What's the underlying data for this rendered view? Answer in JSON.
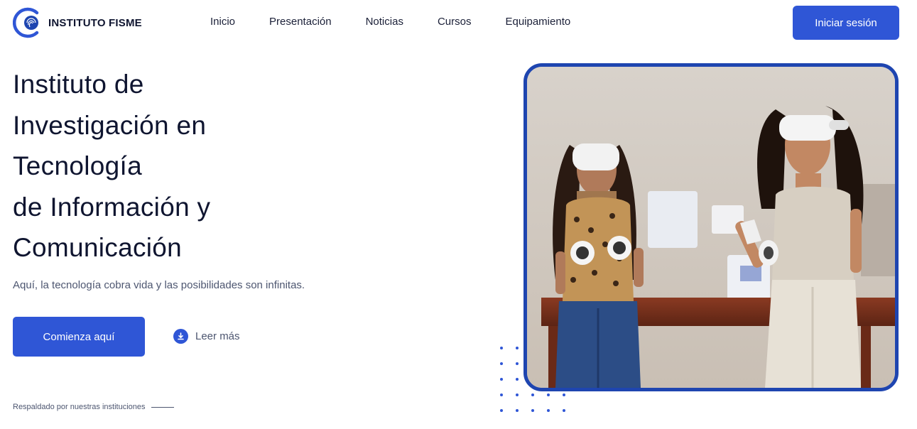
{
  "brand": {
    "name": "INSTITUTO FISME",
    "logo_icon": "fingerprint-c-logo-icon"
  },
  "nav": {
    "items": [
      {
        "label": "Inicio"
      },
      {
        "label": "Presentación"
      },
      {
        "label": "Noticias"
      },
      {
        "label": "Cursos"
      },
      {
        "label": "Equipamiento"
      }
    ],
    "login_label": "Iniciar sesión"
  },
  "hero": {
    "title_lines": [
      "Instituto de",
      "Investigación en",
      "Tecnología",
      "de Información y",
      "Comunicación"
    ],
    "subtitle": "Aquí, la tecnología cobra vida y las posibilidades son infinitas.",
    "cta_label": "Comienza aquí",
    "read_more_label": "Leer más",
    "read_more_icon": "download-icon",
    "backed_label": "Respaldado por nuestras instituciones"
  },
  "colors": {
    "accent": "#2f56d6",
    "frame": "#1e45b0",
    "heading": "#0f1530",
    "muted": "#4d5670"
  }
}
